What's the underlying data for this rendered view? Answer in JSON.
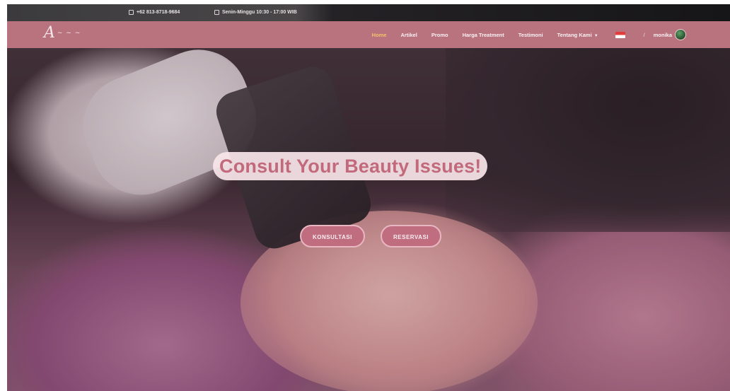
{
  "topbar": {
    "phone": "+62 813-8718-9684",
    "hours": "Senin-Minggu 10:30 - 17:00 WIB"
  },
  "navbar": {
    "logo": "A",
    "logo_suffix": "~ ~ ~",
    "links": [
      "Home",
      "Artikel",
      "Promo",
      "Harga Treatment",
      "Testimoni",
      "Tentang Kami"
    ],
    "active": "Home",
    "user_name": "monika"
  },
  "hero": {
    "headline": "Consult Your Beauty Issues!",
    "buttons": {
      "konsultasi": "KONSULTASI",
      "reservasi": "RESERVASI"
    }
  },
  "colors": {
    "nav_bg": "#b8737f",
    "accent": "#c16d80",
    "active_link": "#f3c06a",
    "headline_text": "#c26a7c"
  },
  "icons": {
    "phone": "phone-icon",
    "clock": "clock-icon",
    "flag": "flag-icon",
    "avatar": "avatar"
  }
}
